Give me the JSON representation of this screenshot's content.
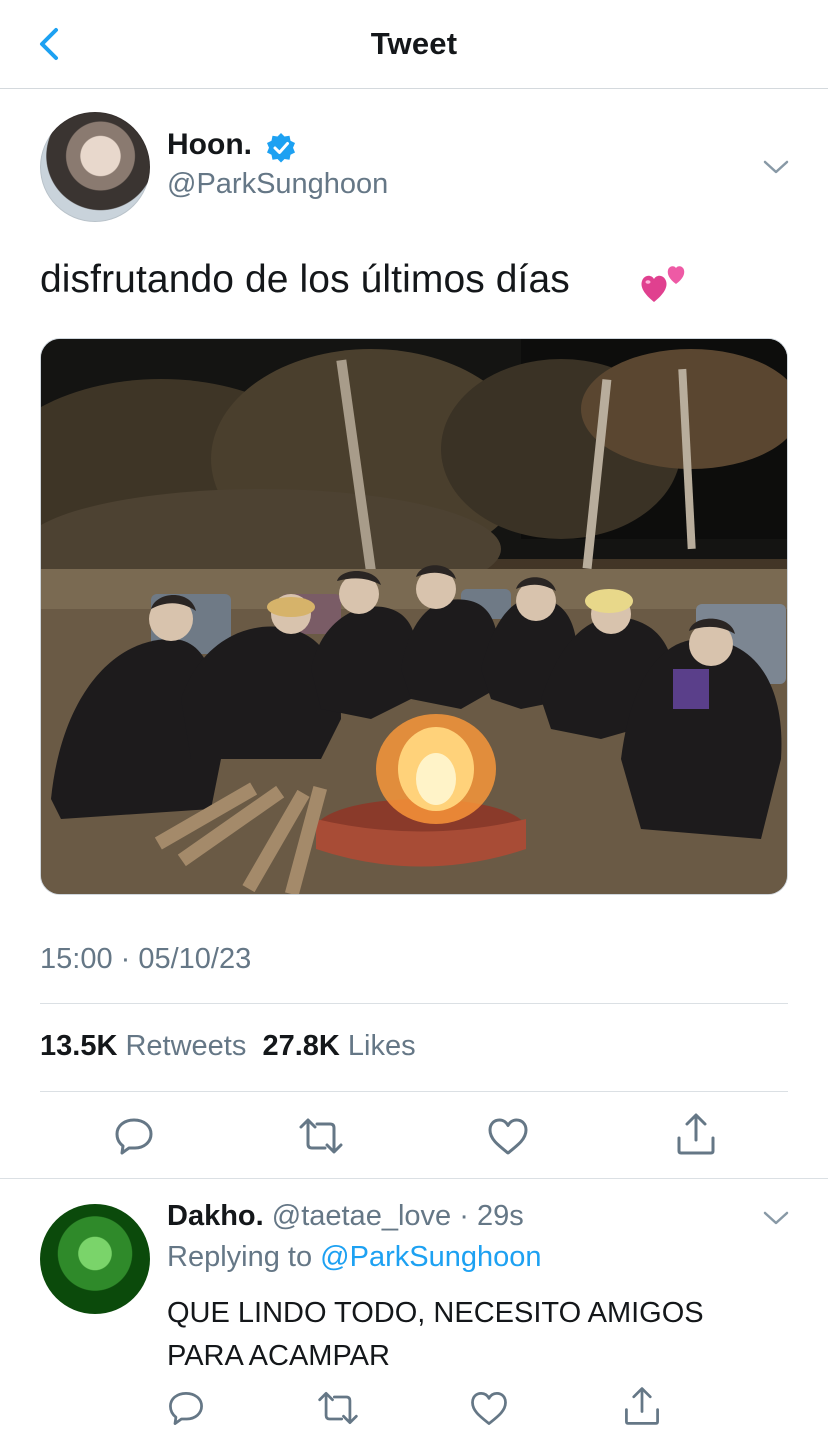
{
  "header": {
    "title": "Tweet",
    "back_icon": "chevron-left-icon",
    "accent": "#1da1f2"
  },
  "tweet": {
    "author_name": "Hoon.",
    "author_handle": "@ParkSunghoon",
    "verified_icon": "verified-badge-icon",
    "text": "disfrutando de los últimos días",
    "emoji": "two-hearts-emoji",
    "timestamp": "15:00 · 05/10/23",
    "retweets_count": "13.5K",
    "retweets_label": "Retweets",
    "likes_count": "27.8K",
    "likes_label": "Likes"
  },
  "reply": {
    "author_name": "Dakho.",
    "author_handle": "@taetae_love",
    "separator": "·",
    "age": "29s",
    "replying_prefix": "Replying to",
    "replying_to": "@ParkSunghoon",
    "text": "QUE LINDO TODO, NECESITO AMIGOS PARA ACAMPAR"
  },
  "actions": [
    "reply-icon",
    "retweet-icon",
    "like-icon",
    "share-icon"
  ]
}
